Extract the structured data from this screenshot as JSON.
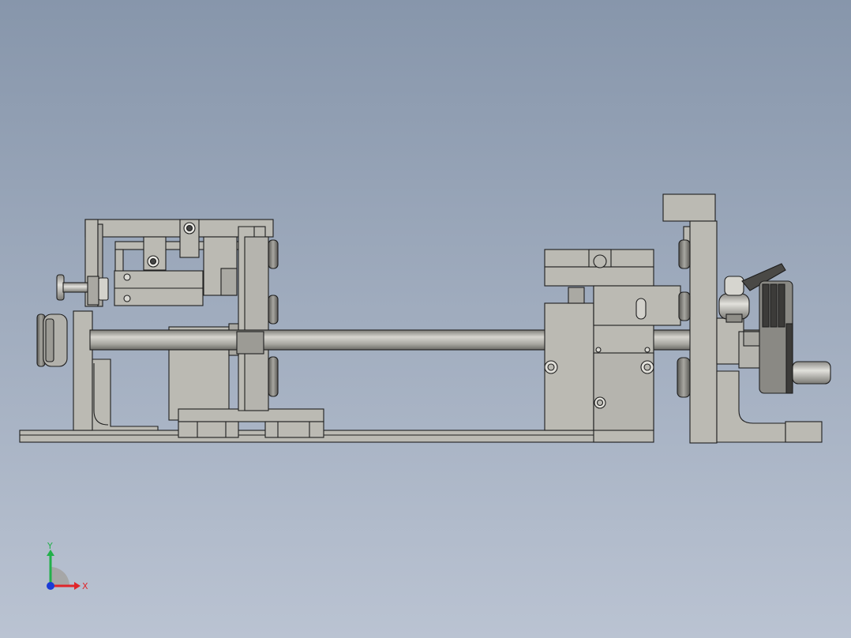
{
  "viewport": {
    "background_top": "#8796ab",
    "background_bottom": "#bac3d2"
  },
  "model": {
    "part_fill": "#bbbab3",
    "part_fill_dark": "#8f8e88",
    "edge_color": "#1e1e1e"
  },
  "triad": {
    "x_label": "X",
    "y_label": "Y",
    "x_color": "#e0252a",
    "y_color": "#22b04a",
    "origin_color": "#1a3bd6"
  }
}
